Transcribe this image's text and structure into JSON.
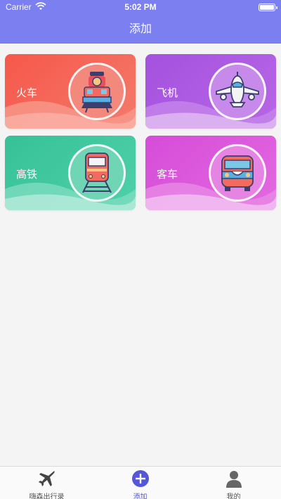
{
  "status_bar": {
    "carrier": "Carrier",
    "time": "5:02 PM"
  },
  "nav": {
    "title": "添加"
  },
  "cards": [
    {
      "label": "火车",
      "icon": "steam-train-icon",
      "color": "#f6584a"
    },
    {
      "label": "飞机",
      "icon": "airplane-icon",
      "color": "#a452df"
    },
    {
      "label": "高铁",
      "icon": "high-speed-rail-icon",
      "color": "#37c196"
    },
    {
      "label": "客车",
      "icon": "bus-icon",
      "color": "#d64cd8"
    }
  ],
  "tabs": [
    {
      "label": "嗨森出行录",
      "icon": "airplane-icon"
    },
    {
      "label": "添加",
      "icon": "plus-icon"
    },
    {
      "label": "我的",
      "icon": "person-icon"
    }
  ],
  "accent": "#7b7ff0"
}
